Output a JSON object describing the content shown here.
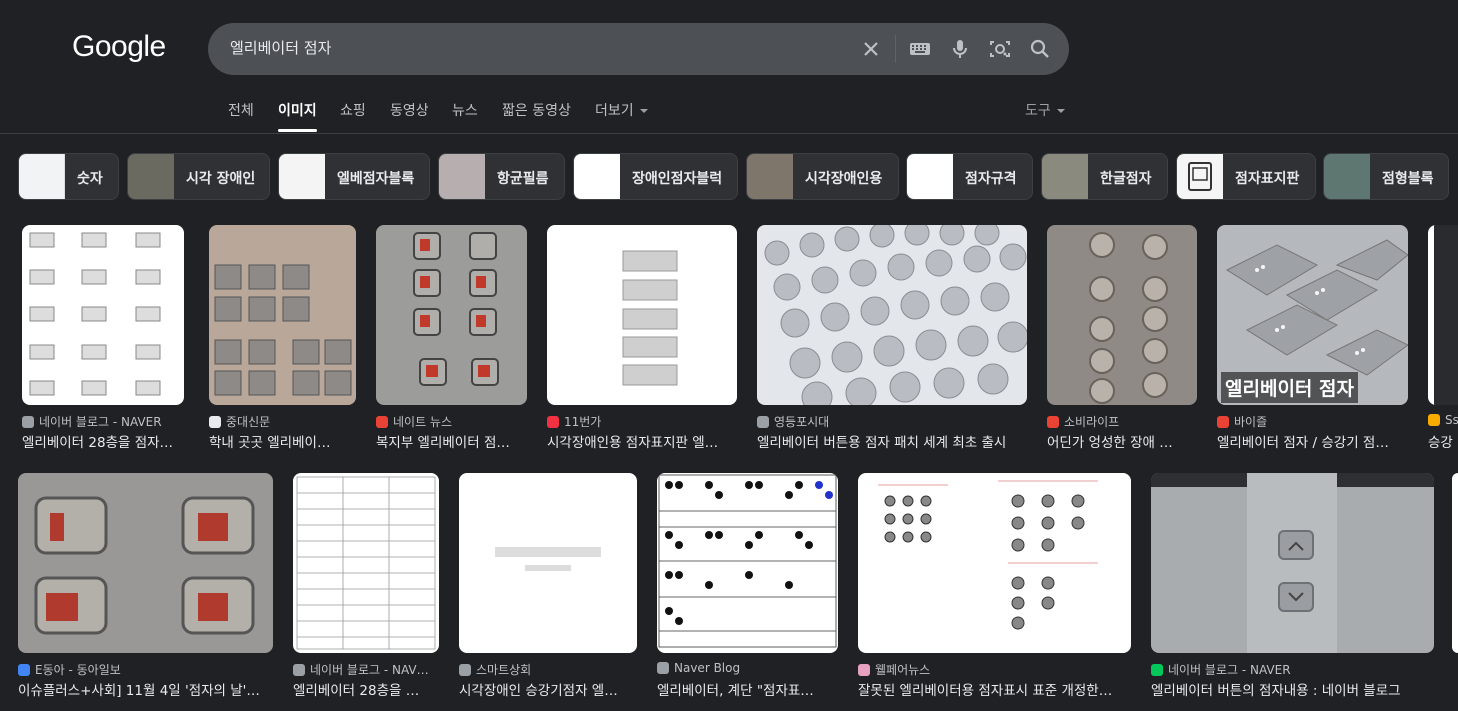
{
  "logo": "Google",
  "search": {
    "query": "엘리베이터 점자"
  },
  "icons": {
    "clear": "close-icon",
    "keyboard": "keyboard-icon",
    "mic": "microphone-icon",
    "lens": "camera-lens-icon",
    "search": "search-icon"
  },
  "tabs": [
    {
      "label": "전체"
    },
    {
      "label": "이미지"
    },
    {
      "label": "쇼핑"
    },
    {
      "label": "동영상"
    },
    {
      "label": "뉴스"
    },
    {
      "label": "짧은 동영상"
    },
    {
      "label": "더보기"
    }
  ],
  "tools_label": "도구",
  "chips": [
    {
      "label": "숫자"
    },
    {
      "label": "시각 장애인"
    },
    {
      "label": "엘베점자블록"
    },
    {
      "label": "항균필름"
    },
    {
      "label": "장애인점자블럭"
    },
    {
      "label": "시각장애인용"
    },
    {
      "label": "점자규격"
    },
    {
      "label": "한글점자"
    },
    {
      "label": "점자표지판"
    },
    {
      "label": "점형블록"
    }
  ],
  "row1": [
    {
      "source": "네이버 블로그 - NAVER",
      "title": "엘리베이터 28층을 점자…",
      "fav": "#9aa0a6"
    },
    {
      "source": "중대신문",
      "title": "학내 곳곳 엘리베이…",
      "fav": "#e8eaed"
    },
    {
      "source": "네이트 뉴스",
      "title": "복지부 엘리베이터 점…",
      "fav": "#ea4335"
    },
    {
      "source": "11번가",
      "title": "시각장애인용 점자표지판 엘…",
      "fav": "#f43142"
    },
    {
      "source": "영등포시대",
      "title": "엘리베이터 버튼용 점자 패치 세계 최초 출시",
      "fav": "#9aa0a6"
    },
    {
      "source": "소비라이프",
      "title": "어딘가 엉성한 장애 …",
      "fav": "#ea4335"
    },
    {
      "source": "바이즐",
      "title": "엘리베이터 점자 / 승강기 점…",
      "fav": "#ea4335",
      "overlay": "엘리베이터 점자"
    },
    {
      "source": "Ss",
      "title": "승강",
      "fav": "#f9ab00"
    }
  ],
  "row2": [
    {
      "source": "E동아 - 동아일보",
      "title": "이슈플러스+사회] 11월 4일 '점자의 날'…",
      "fav": "#4285f4"
    },
    {
      "source": "네이버 블로그 - NAV…",
      "title": "엘리베이터 28층을 …",
      "fav": "#9aa0a6"
    },
    {
      "source": "스마트상회",
      "title": "시각장애인 승강기점자 엘…",
      "fav": "#9aa0a6"
    },
    {
      "source": "Naver Blog",
      "title": "엘리베이터, 계단 \"점자표…",
      "fav": "#9aa0a6"
    },
    {
      "source": "웰페어뉴스",
      "title": "잘못된 엘리베이터용 점자표시 표준 개정한…",
      "fav": "#e8a0c0"
    },
    {
      "source": "네이버 블로그 - NAVER",
      "title": "엘리베이터 버튼의 점자내용 : 네이버 블로그",
      "fav": "#03c75a"
    }
  ]
}
